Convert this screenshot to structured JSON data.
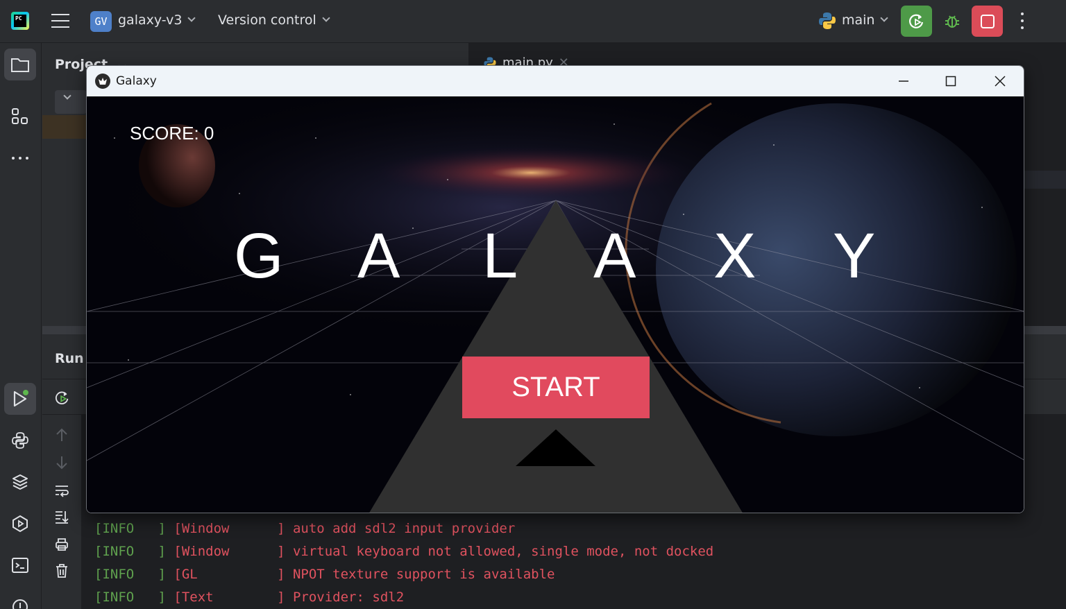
{
  "topbar": {
    "project_badge": "GV",
    "project_name": "galaxy-v3",
    "version_control": "Version control",
    "run_config": "main"
  },
  "project_panel": {
    "title": "Project"
  },
  "editor": {
    "tab_label": "main.py"
  },
  "run_panel": {
    "title": "Run"
  },
  "console": {
    "lines": [
      {
        "level": "[INFO   ]",
        "source": " [Window      ]",
        "message": " auto add sdl2 input provider"
      },
      {
        "level": "[INFO   ]",
        "source": " [Window      ]",
        "message": " virtual keyboard not allowed, single mode, not docked"
      },
      {
        "level": "[INFO   ]",
        "source": " [GL          ]",
        "message": " NPOT texture support is available"
      },
      {
        "level": "[INFO   ]",
        "source": " [Text        ]",
        "message": " Provider: sdl2"
      }
    ]
  },
  "game_window": {
    "title": "Galaxy",
    "score_label": "SCORE: 0",
    "game_title_letters": [
      "G",
      "A",
      "L",
      "A",
      "X",
      "Y"
    ],
    "start_label": "START"
  },
  "colors": {
    "start_button": "#e14a5e",
    "rerun_button": "#4e9a48",
    "stop_button": "#db4c58",
    "console_text": "#e0525f",
    "console_level": "#5fa14e"
  }
}
